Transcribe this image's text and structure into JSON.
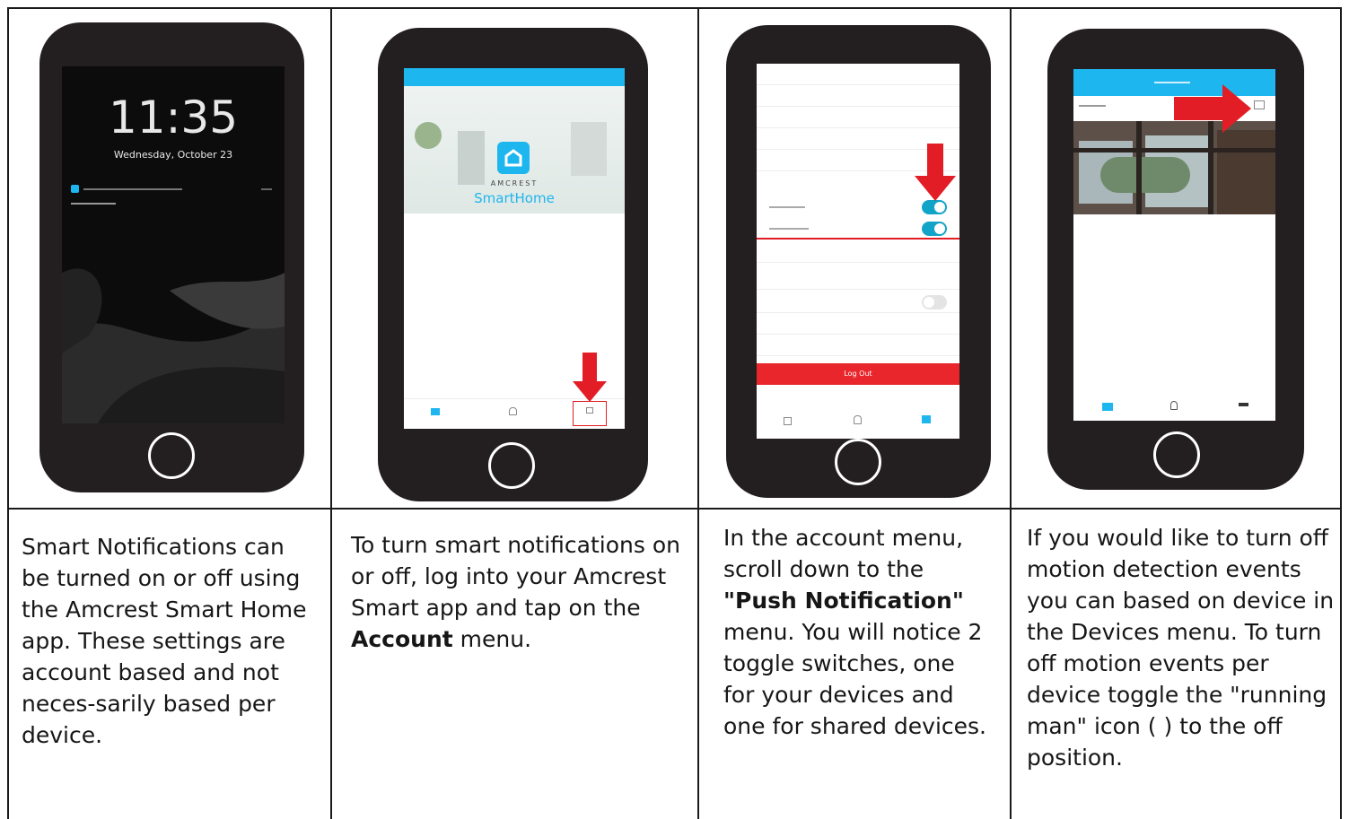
{
  "panels": [
    {
      "lock_time": "11:35",
      "lock_date": "Wednesday, October 23",
      "paragraph": "Smart Notifications can be turned on or off using the Amcrest Smart Home app. These settings are account based and not neces-sarily based per device."
    },
    {
      "logo_brand": "AMCREST",
      "logo_product": "SmartHome",
      "paragraph": "To turn smart notifications on or off, log into your Amcrest Smart app and tap on the ",
      "paragraph_bold": "Account",
      "paragraph_tail": " menu."
    },
    {
      "logout_label": "Log Out",
      "paragraph": "In the account menu, scroll down to the ",
      "paragraph_bold": "\"Push Notification\"",
      "paragraph_tail": " menu. You will notice 2 toggle switches, one for your devices and one for shared devices."
    },
    {
      "paragraph": "If you would like to turn off motion detection events you can based on device in the Devices menu. To turn off motion events per device toggle the \"running man\" icon (      ) to the off position."
    }
  ],
  "colors": {
    "phone_body": "#231f20",
    "arrow_red": "#e31d25",
    "app_blue": "#1eb6ee",
    "toggle_on": "#12a3c9",
    "logout_red": "#e8262b"
  }
}
